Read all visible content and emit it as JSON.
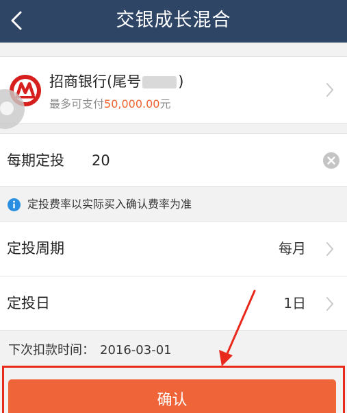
{
  "header": {
    "title": "交银成长混合",
    "back_icon": "chevron-left-icon"
  },
  "bank": {
    "name_prefix": "招商银行(尾号",
    "name_suffix": ")",
    "limit_prefix": "最多可支付",
    "limit_amount": "50,000.00",
    "limit_unit": "元",
    "logo_icon": "cmb-bank-logo-icon"
  },
  "amount": {
    "label": "每期定投",
    "value": "20"
  },
  "notice": {
    "text": "定投费率以实际买入确认费率为准"
  },
  "cycle": {
    "label": "定投周期",
    "value": "每月"
  },
  "day": {
    "label": "定投日",
    "value": "1日"
  },
  "next": {
    "label": "下次扣款时间：",
    "date": "2016-03-01"
  },
  "confirm": {
    "label": "确认"
  },
  "colors": {
    "header_bg": "#2e4566",
    "accent": "#f0643a",
    "annotation": "#e8291c",
    "info_blue": "#2a8fe0"
  }
}
